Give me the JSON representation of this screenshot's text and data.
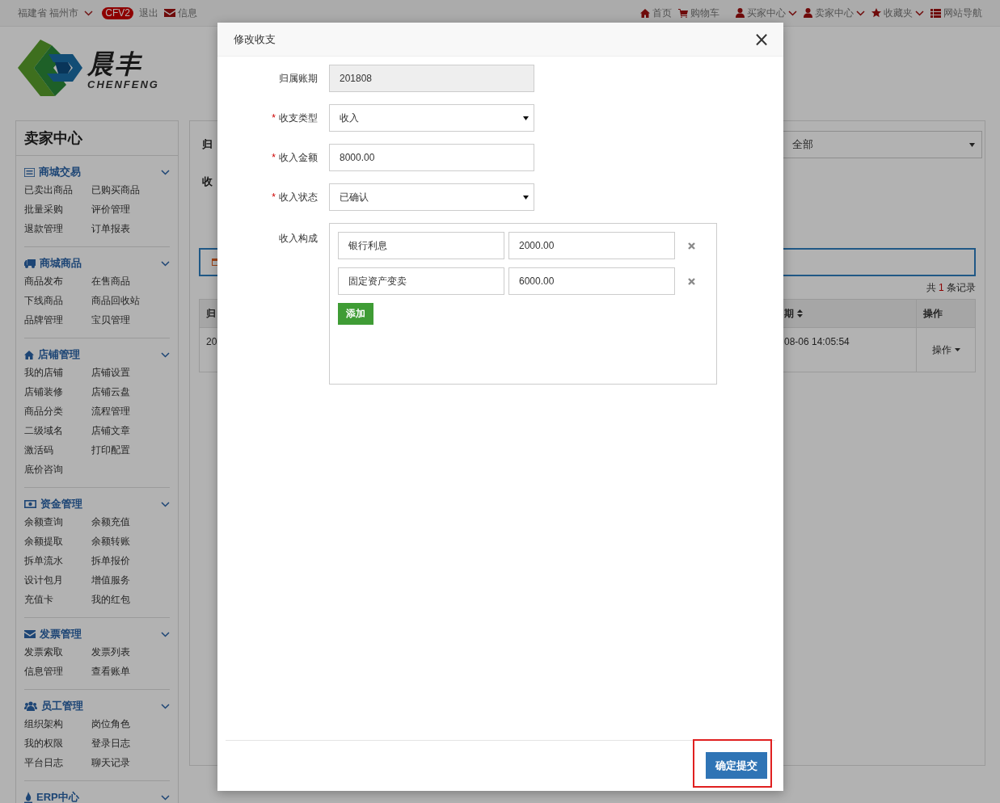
{
  "top_bar": {
    "location": "福建省 福州市",
    "badge": "CFV2",
    "logout": "退出",
    "messages": "信息",
    "nav": [
      {
        "label": "首页",
        "kind": "home",
        "dropdown": false
      },
      {
        "label": "购物车",
        "kind": "cart",
        "dropdown": false
      },
      {
        "label": "买家中心",
        "kind": "user",
        "dropdown": true
      },
      {
        "label": "卖家中心",
        "kind": "user",
        "dropdown": true
      },
      {
        "label": "收藏夹",
        "kind": "star",
        "dropdown": true
      },
      {
        "label": "网站导航",
        "kind": "list",
        "dropdown": false
      }
    ]
  },
  "logo": {
    "name": "晨丰",
    "latin": "CHENFENG"
  },
  "sidebar": {
    "title": "卖家中心",
    "groups": [
      {
        "title": "商城交易",
        "kind": "list",
        "items": [
          "已卖出商品",
          "已购买商品",
          "批量采购",
          "评价管理",
          "退款管理",
          "订单报表"
        ]
      },
      {
        "title": "商城商品",
        "kind": "truck",
        "items": [
          "商品发布",
          "在售商品",
          "下线商品",
          "商品回收站",
          "品牌管理",
          "宝贝管理"
        ]
      },
      {
        "title": "店铺管理",
        "kind": "home",
        "items": [
          "我的店铺",
          "店铺设置",
          "店铺装修",
          "店铺云盘",
          "商品分类",
          "流程管理",
          "二级域名",
          "店铺文章",
          "激活码",
          "打印配置",
          "底价咨询"
        ]
      },
      {
        "title": "资金管理",
        "kind": "money",
        "items": [
          "余额查询",
          "余额充值",
          "余额提取",
          "余额转账",
          "拆单流水",
          "拆单报价",
          "设计包月",
          "增值服务",
          "充值卡",
          "我的红包"
        ]
      },
      {
        "title": "发票管理",
        "kind": "envelope",
        "items": [
          "发票索取",
          "发票列表",
          "信息管理",
          "查看账单"
        ]
      },
      {
        "title": "员工管理",
        "kind": "users",
        "items": [
          "组织架构",
          "岗位角色",
          "我的权限",
          "登录日志",
          "平台日志",
          "聊天记录"
        ]
      },
      {
        "title": "ERP中心",
        "kind": "fire"
      }
    ]
  },
  "main": {
    "filter_label": "归",
    "type_label": "收",
    "select_value": "全部",
    "total": {
      "prefix": "共",
      "count": "1",
      "suffix": "条记录"
    },
    "table": {
      "columns": [
        {
          "label": "归",
          "sortable": false
        },
        {
          "label": "期",
          "sortable": true
        },
        {
          "label": "操作",
          "sortable": false
        }
      ],
      "rows": [
        {
          "cells": [
            "20",
            "08-06 14:05:54"
          ],
          "action": "操作"
        }
      ]
    }
  },
  "modal": {
    "title": "修改收支",
    "close": "×",
    "required_mark": "*",
    "fields": [
      {
        "label": "归属账期",
        "required": false,
        "kind": "readonly",
        "value": "201808"
      },
      {
        "label": "收支类型",
        "required": true,
        "kind": "select",
        "value": "收入"
      },
      {
        "label": "收入金额",
        "required": true,
        "kind": "input",
        "value": "8000.00"
      },
      {
        "label": "收入状态",
        "required": true,
        "kind": "select",
        "value": "已确认"
      }
    ],
    "composition": {
      "label": "收入构成",
      "rows": [
        {
          "name": "银行利息",
          "amount": "2000.00"
        },
        {
          "name": "固定资产变卖",
          "amount": "6000.00"
        }
      ],
      "add_button": "添加"
    },
    "submit": {
      "label": "确定提交",
      "highlighted": true
    }
  }
}
